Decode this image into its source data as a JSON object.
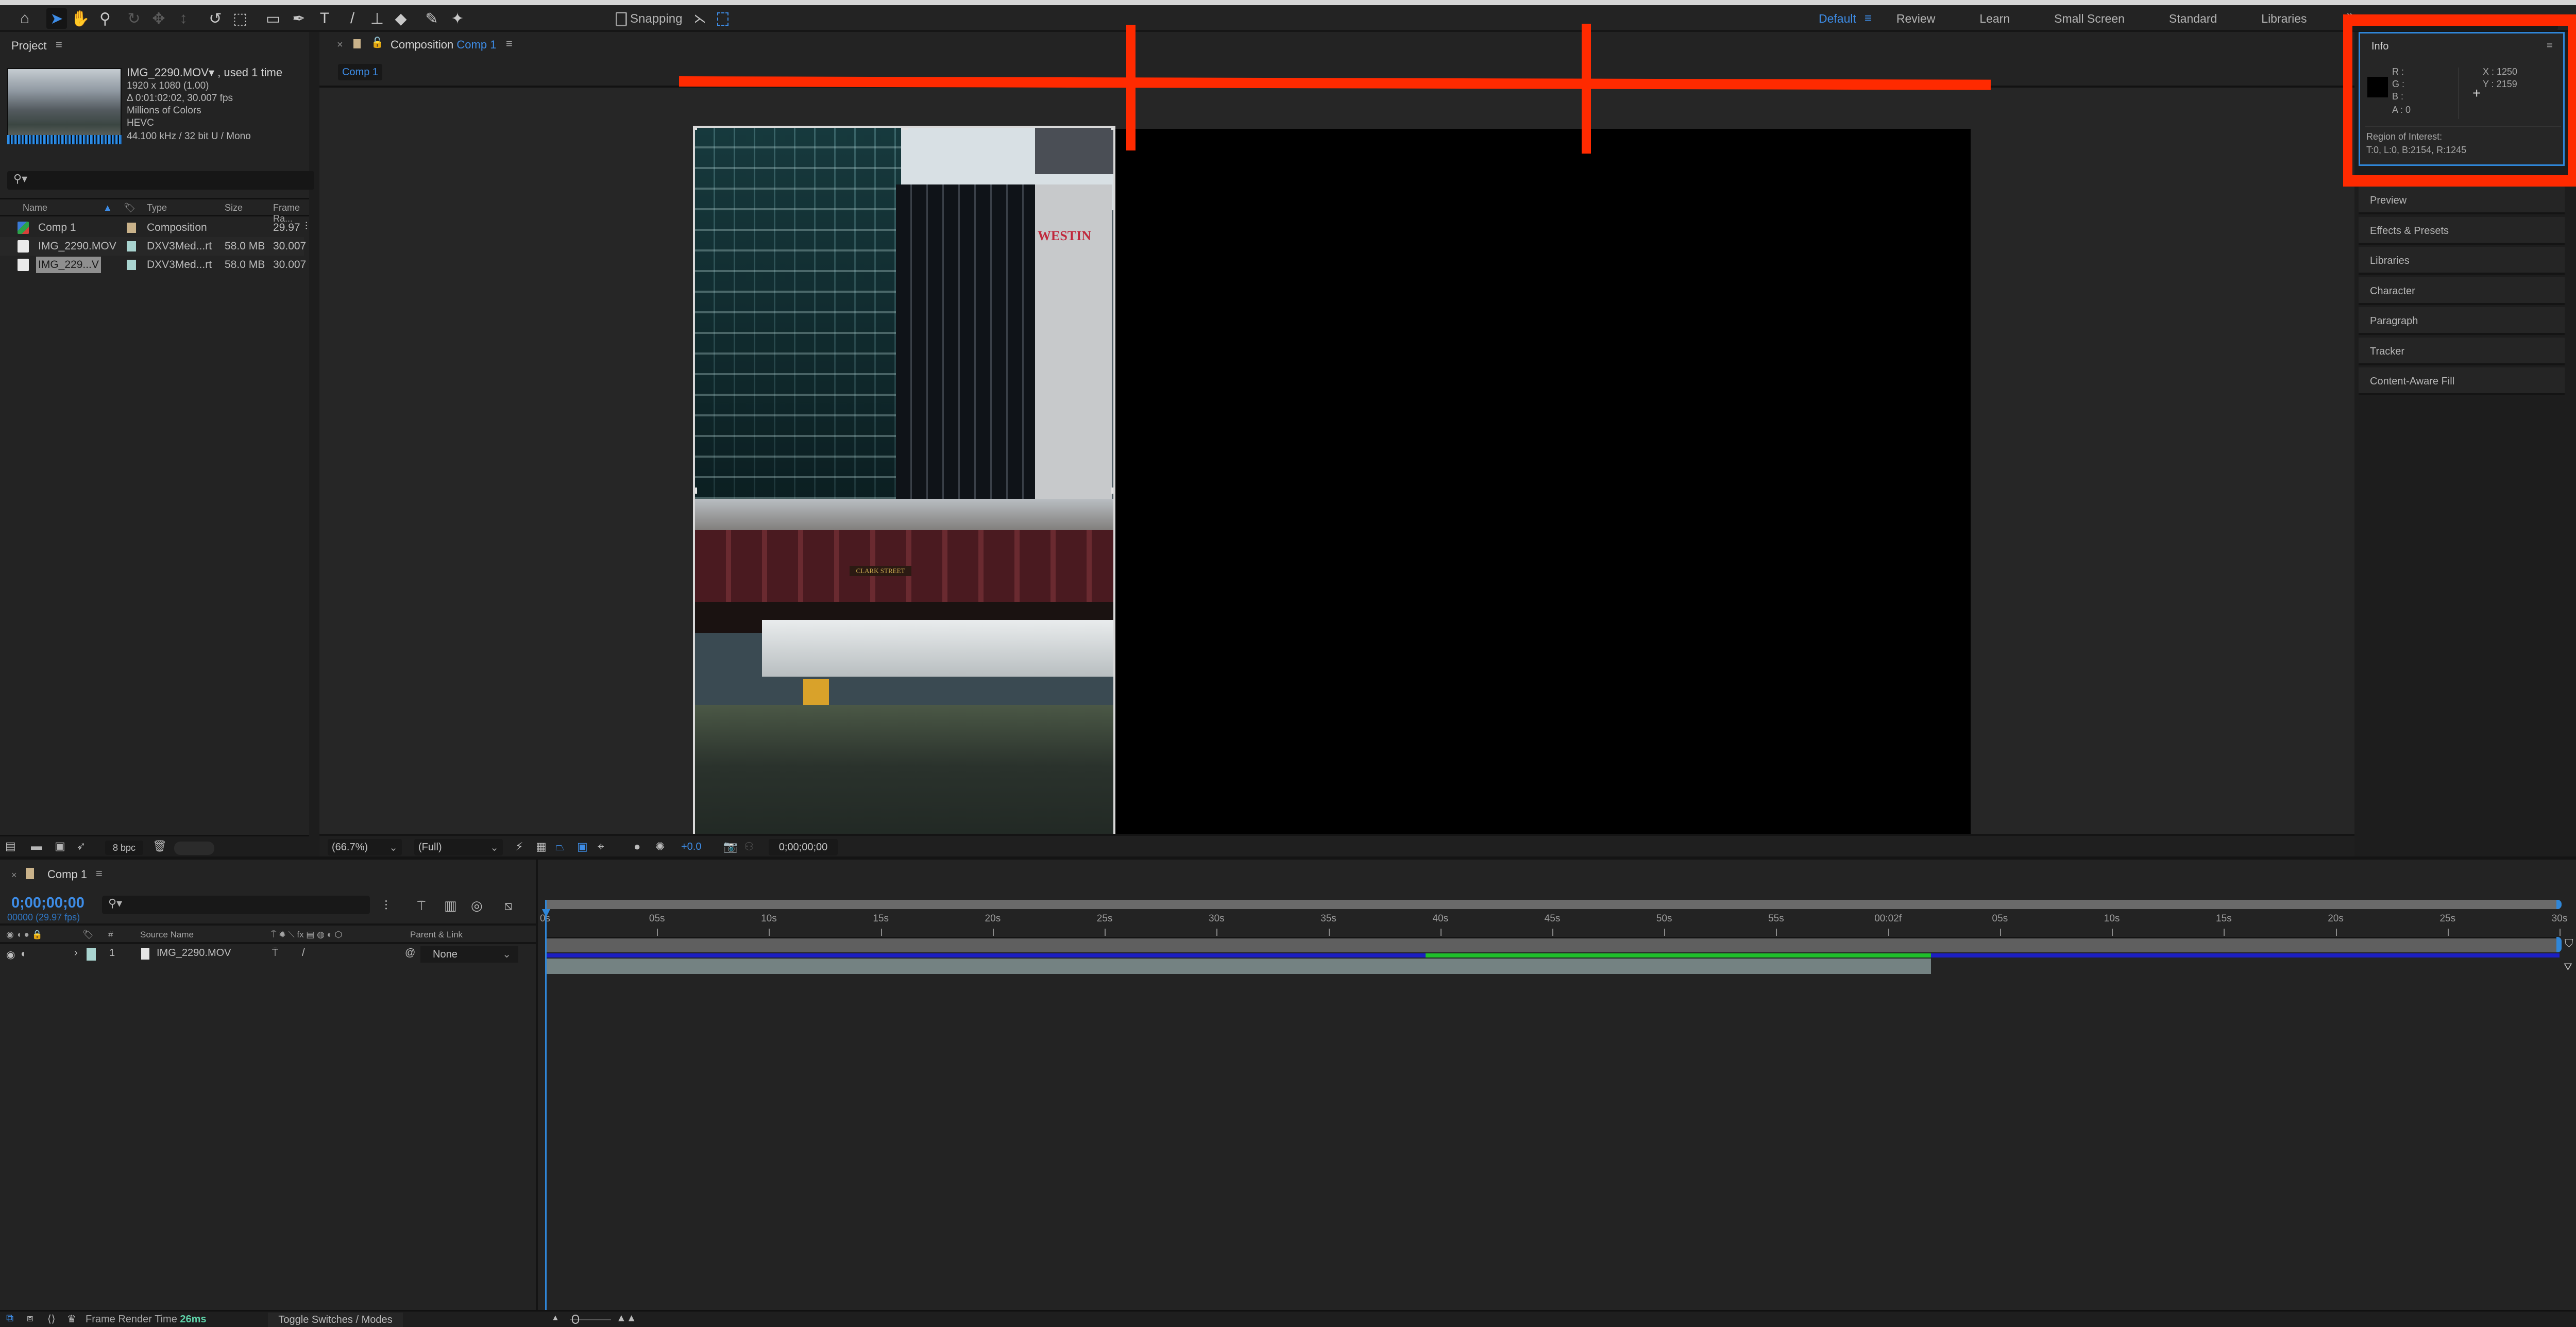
{
  "toolbar": {
    "tools": [
      {
        "name": "home-icon",
        "glyph": "⌂"
      },
      {
        "name": "selection-tool-icon",
        "glyph": "➤",
        "active": true
      },
      {
        "name": "hand-tool-icon",
        "glyph": "✋"
      },
      {
        "name": "zoom-tool-icon",
        "glyph": "⚲"
      },
      {
        "name": "orbit-camera-icon",
        "glyph": "↻",
        "dim": true
      },
      {
        "name": "pan-camera-icon",
        "glyph": "✥",
        "dim": true
      },
      {
        "name": "dolly-camera-icon",
        "glyph": "↕",
        "dim": true
      },
      {
        "name": "rotate-tool-icon",
        "glyph": "↺"
      },
      {
        "name": "pan-behind-icon",
        "glyph": "⬚"
      },
      {
        "name": "rectangle-tool-icon",
        "glyph": "▭"
      },
      {
        "name": "pen-tool-icon",
        "glyph": "✒"
      },
      {
        "name": "type-tool-icon",
        "glyph": "T"
      },
      {
        "name": "brush-tool-icon",
        "glyph": "/"
      },
      {
        "name": "clone-stamp-icon",
        "glyph": "⊥"
      },
      {
        "name": "eraser-tool-icon",
        "glyph": "◆"
      },
      {
        "name": "roto-brush-icon",
        "glyph": "✎"
      },
      {
        "name": "puppet-tool-icon",
        "glyph": "✦"
      }
    ],
    "snapping_label": "Snapping"
  },
  "workspaces": {
    "active": "Default",
    "items": [
      "Review",
      "Learn",
      "Small Screen",
      "Standard",
      "Libraries"
    ],
    "more": "»"
  },
  "project": {
    "title": "Project",
    "selected_file": {
      "name": "IMG_2290.MOV",
      "usage": "▾ , used 1 time",
      "meta": [
        "1920 x 1080 (1.00)",
        "Δ 0:01:02:02, 30.007 fps",
        "Millions of Colors",
        "HEVC",
        "44.100 kHz / 32 bit U / Mono"
      ]
    },
    "search_placeholder": "",
    "columns": {
      "name": "Name",
      "type": "Type",
      "size": "Size",
      "frame_rate": "Frame Ra..."
    },
    "items": [
      {
        "name": "Comp 1",
        "type": "Composition",
        "size": "",
        "frame_rate": "29.97",
        "label_color": "#c9b28a",
        "kind": "comp",
        "selected": false
      },
      {
        "name": "IMG_2290.MOV",
        "type": "DXV3Med...rt",
        "size": "58.0 MB",
        "frame_rate": "30.007",
        "label_color": "#a9d4d0",
        "kind": "footage",
        "selected": false
      },
      {
        "name": "IMG_229...V",
        "type": "DXV3Med...rt",
        "size": "58.0 MB",
        "frame_rate": "30.007",
        "label_color": "#a9d4d0",
        "kind": "footage",
        "selected": true
      }
    ],
    "bit_depth": "8 bpc"
  },
  "composition": {
    "tab_prefix": "Composition",
    "tab_name": "Comp 1",
    "breadcrumb": "Comp 1",
    "zoom": "(66.7%)",
    "resolution": "(Full)",
    "exposure": "+0.0",
    "timecode": "0;00;00;00",
    "overlay_text": {
      "hotel_sign": "WESTIN",
      "bridge_sign": "CLARK STREET"
    }
  },
  "info": {
    "title": "Info",
    "r": "R :",
    "g": "G :",
    "b": "B :",
    "a": "A :  0",
    "x": "X :  1250",
    "y": "Y :  2159",
    "roi_label": "Region of Interest:",
    "roi_value": "T:0, L:0, B:2154, R:1245"
  },
  "right_panels": [
    "Preview",
    "Effects & Presets",
    "Libraries",
    "Character",
    "Paragraph",
    "Tracker",
    "Content-Aware Fill"
  ],
  "timeline": {
    "tab_name": "Comp 1",
    "timecode": "0;00;00;00",
    "frames": "00000 (29.97 fps)",
    "columns": {
      "num": "#",
      "source_name": "Source Name",
      "parent": "Parent & Link"
    },
    "layers": [
      {
        "index": "1",
        "name": "IMG_2290.MOV",
        "parent": "None",
        "label_color": "#a9d4d0"
      }
    ],
    "ruler_labels": [
      "0s",
      "05s",
      "10s",
      "15s",
      "20s",
      "25s",
      "30s",
      "35s",
      "40s",
      "45s",
      "50s",
      "55s",
      "00:02f",
      "05s",
      "10s",
      "15s",
      "20s",
      "25s",
      "30s"
    ],
    "layer_duration_fraction": 0.688,
    "cache_green_start_fraction": 0.437,
    "cache_green_end_fraction": 0.688
  },
  "status": {
    "render_label": "Frame Render Time",
    "render_value": "26ms",
    "toggle_label": "Toggle Switches / Modes"
  }
}
